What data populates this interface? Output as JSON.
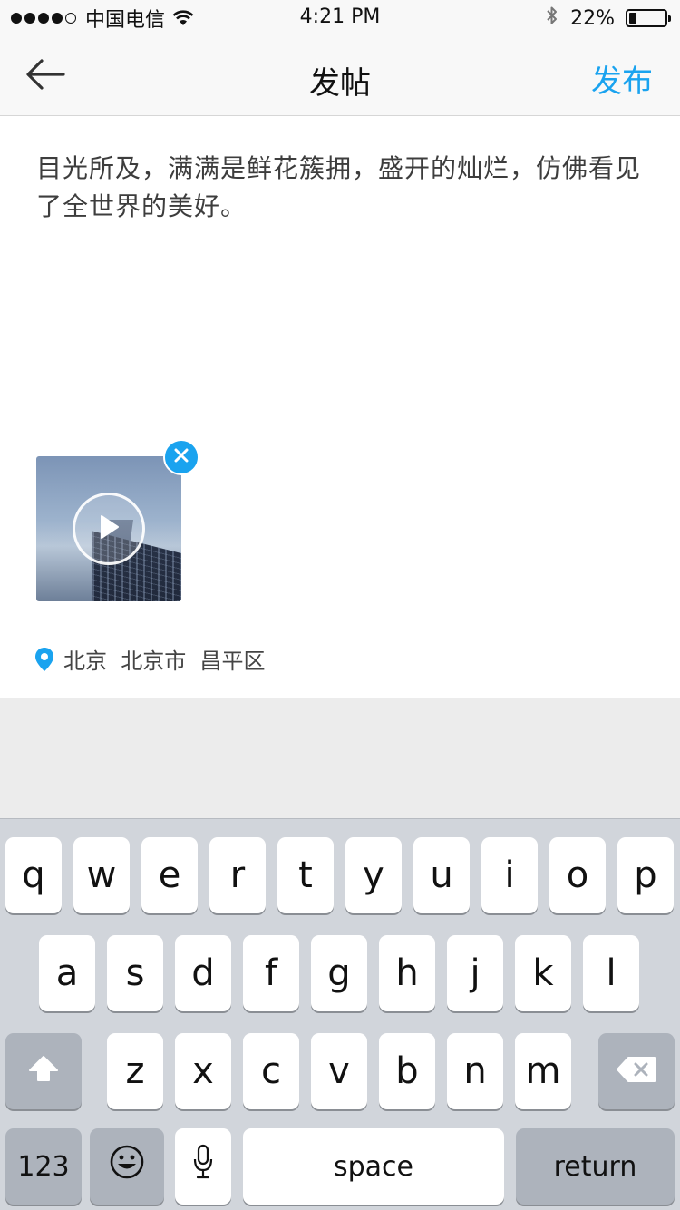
{
  "status_bar": {
    "carrier": "中国电信",
    "time": "4:21 PM",
    "battery_percent": "22%",
    "battery_level": 0.22,
    "signal_bars_filled": 4,
    "signal_bars_total": 5
  },
  "nav": {
    "back_icon": "arrow-left-icon",
    "title": "发帖",
    "publish_label": "发布"
  },
  "post": {
    "text": "目光所及，满满是鲜花簇拥，盛开的灿烂，仿佛看见了全世界的美好。",
    "media": {
      "type": "video",
      "play_icon": "play-icon",
      "remove_icon": "close-icon"
    },
    "location": {
      "icon": "location-pin-icon",
      "text": "北京  北京市  昌平区"
    }
  },
  "keyboard": {
    "row1": [
      "q",
      "w",
      "e",
      "r",
      "t",
      "y",
      "u",
      "i",
      "o",
      "p"
    ],
    "row2": [
      "a",
      "s",
      "d",
      "f",
      "g",
      "h",
      "j",
      "k",
      "l"
    ],
    "row3": [
      "z",
      "x",
      "c",
      "v",
      "b",
      "n",
      "m"
    ],
    "shift_icon": "shift-icon",
    "delete_icon": "backspace-icon",
    "numbers_label": "123",
    "emoji_icon": "emoji-icon",
    "mic_icon": "microphone-icon",
    "space_label": "space",
    "return_label": "return"
  },
  "colors": {
    "accent": "#1aa3ef",
    "keyboard_bg": "#d1d5db",
    "key_dark": "#adb3bc"
  }
}
